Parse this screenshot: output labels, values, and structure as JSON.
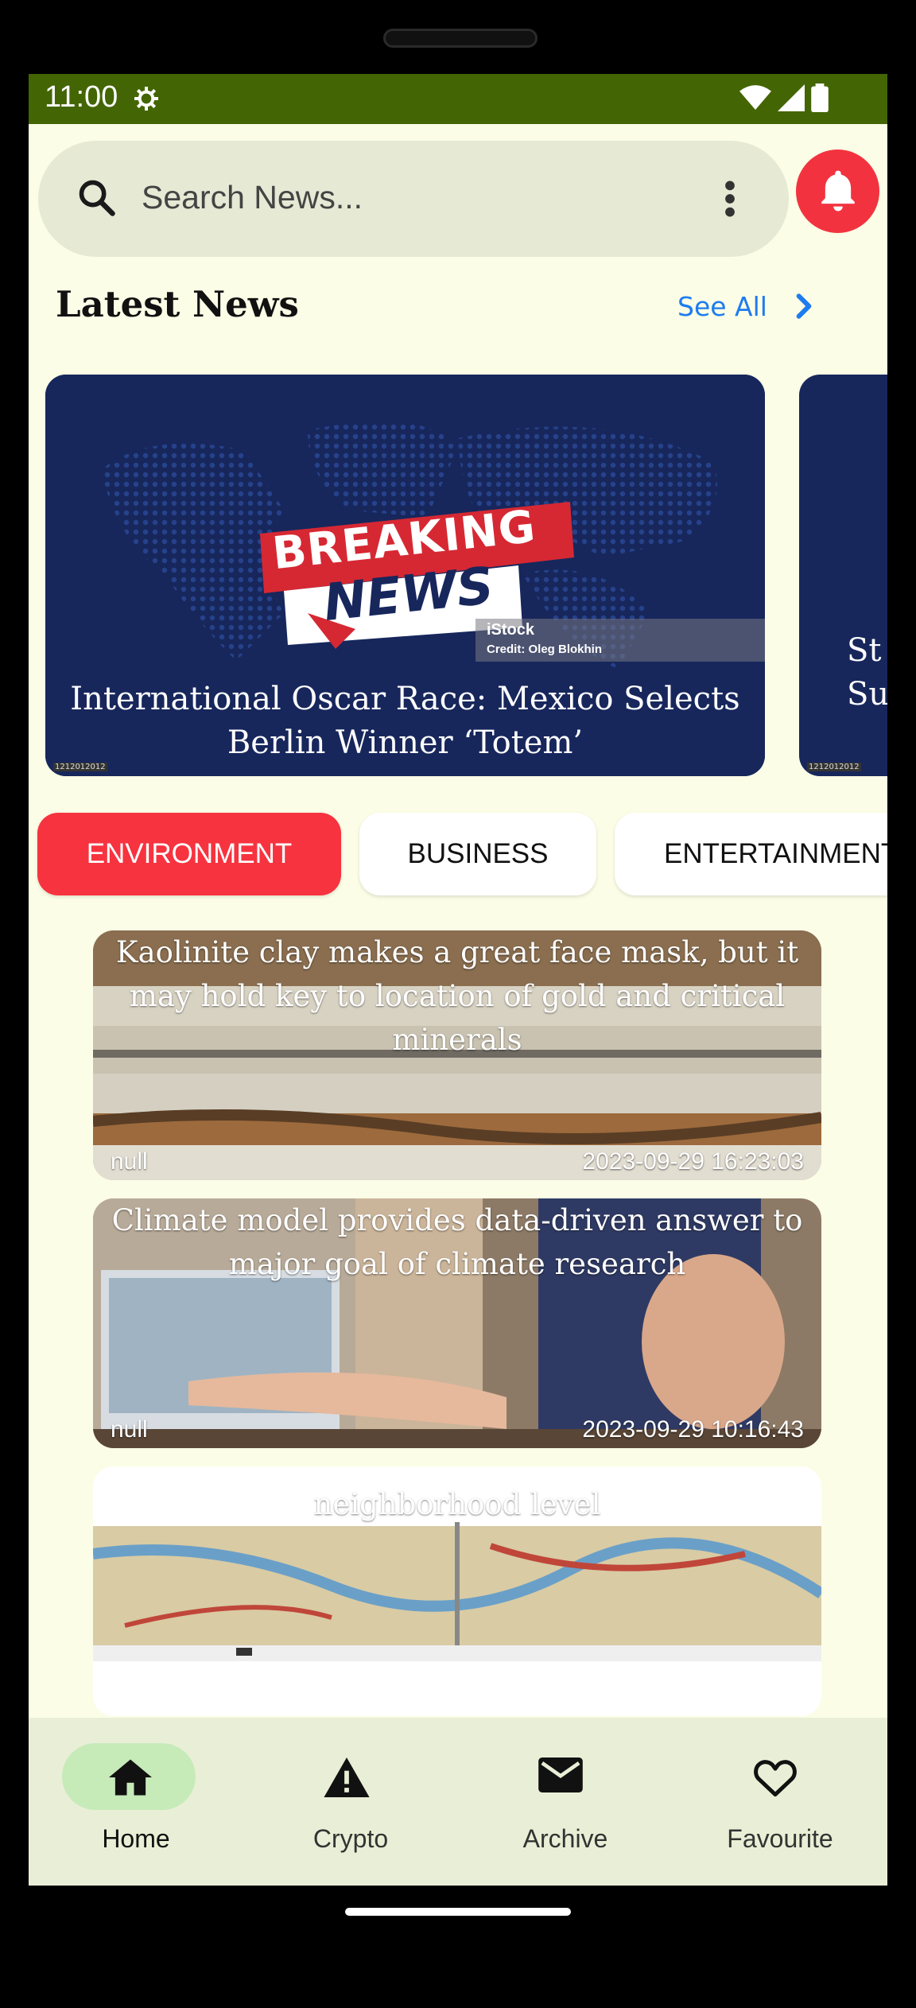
{
  "status_bar": {
    "time": "11:00",
    "icons": [
      "gear-icon",
      "wifi-icon",
      "signal-icon",
      "battery-icon"
    ]
  },
  "search": {
    "placeholder": "Search News...",
    "value": ""
  },
  "latest": {
    "title": "Latest News",
    "see_all": "See All"
  },
  "hero_cards": [
    {
      "title": "International Oscar Race: Mexico Selects Berlin Winner ‘Totem’",
      "image_banner_top": "BREAKING",
      "image_banner_bottom": "NEWS",
      "image_credit": "iStock",
      "image_credit_line": "Credit: Oleg Blokhin",
      "tag": "1212012012"
    },
    {
      "title": "St Su",
      "tag": "1212012012"
    }
  ],
  "categories": [
    {
      "label": "ENVIRONMENT",
      "selected": true
    },
    {
      "label": "BUSINESS",
      "selected": false
    },
    {
      "label": "ENTERTAINMENT",
      "selected": false
    }
  ],
  "articles": [
    {
      "title": "Kaolinite clay makes a great face mask, but it may hold key to location of gold and critical minerals",
      "source": "null",
      "date": "2023-09-29 16:23:03"
    },
    {
      "title": "Climate model provides data-driven answer to major goal of climate research",
      "source": "null",
      "date": "2023-09-29 10:16:43"
    },
    {
      "title": "neighborhood level",
      "source": "",
      "date": ""
    }
  ],
  "bottom_nav": [
    {
      "label": "Home",
      "icon": "home-icon",
      "active": true
    },
    {
      "label": "Crypto",
      "icon": "warning-icon",
      "active": false
    },
    {
      "label": "Archive",
      "icon": "mail-icon",
      "active": false
    },
    {
      "label": "Favourite",
      "icon": "heart-icon",
      "active": false
    }
  ],
  "colors": {
    "status_bar": "#436504",
    "accent_red": "#f2333f",
    "link_blue": "#1e7cf0",
    "background": "#fbfde6",
    "nav_active": "#c7eab9"
  }
}
